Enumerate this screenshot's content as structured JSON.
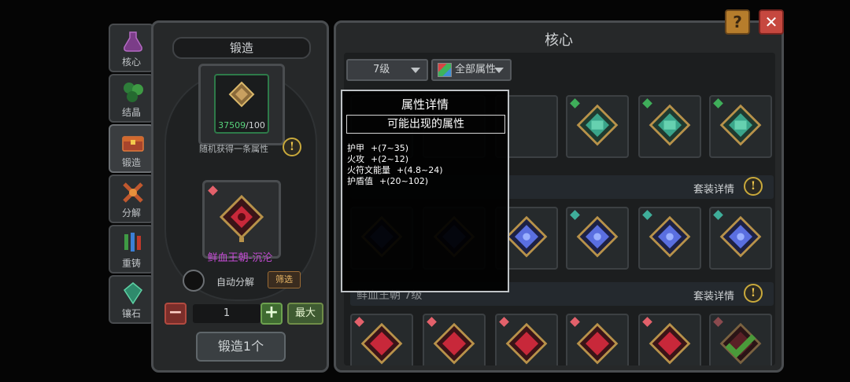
{
  "side_tabs": [
    {
      "label": "核心",
      "icon": "core-flask-icon",
      "active": false
    },
    {
      "label": "结晶",
      "icon": "crystal-icon",
      "active": false
    },
    {
      "label": "锻造",
      "icon": "forge-chest-icon",
      "active": true
    },
    {
      "label": "分解",
      "icon": "decompose-icon",
      "active": false
    },
    {
      "label": "重铸",
      "icon": "recast-icon",
      "active": false
    },
    {
      "label": "镶石",
      "icon": "inlay-stone-icon",
      "active": false
    }
  ],
  "forge": {
    "title": "锻造",
    "material_current": "37509",
    "material_separator": "/100",
    "random_attr_text": "随机获得一条属性",
    "result_name": "鲜血王朝-沉沦",
    "auto_decompose_label": "自动分解",
    "filter_label": "筛选",
    "quantity": "1",
    "minus_label": "−",
    "plus_label": "+",
    "max_label": "最大",
    "forge_button_label": "锻造1个"
  },
  "core": {
    "title": "核心",
    "level_filter": "7级",
    "attr_filter": "全部属性",
    "sets": [
      {
        "name": "",
        "detail_label": "套装详情"
      },
      {
        "name": "鲜血王朝 7级",
        "detail_label": "套装详情"
      }
    ]
  },
  "tooltip": {
    "title": "属性详情",
    "subtitle": "可能出现的属性",
    "stats": [
      {
        "name": "护甲",
        "range": "+(7~35)"
      },
      {
        "name": "火攻",
        "range": "+(2~12)"
      },
      {
        "name": "火符文能量",
        "range": "+(4.8~24)"
      },
      {
        "name": "护盾值",
        "range": "+(20~102)"
      }
    ]
  },
  "buttons": {
    "help": "?",
    "close": "✕"
  },
  "colors": {
    "green_core": "#3aa58a",
    "blue_core": "#5a6fe0",
    "red_core": "#c8283a",
    "gold_frame": "#b8924a",
    "selected_check": "#4a9a3a"
  }
}
